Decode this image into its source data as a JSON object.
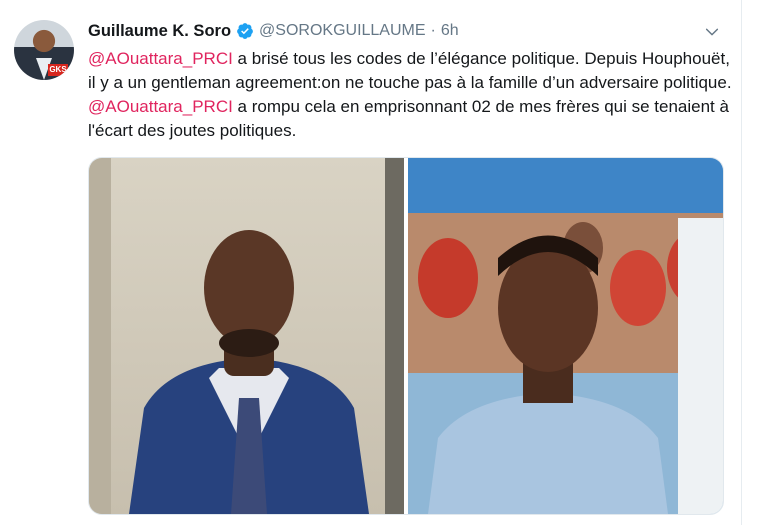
{
  "tweet": {
    "author": {
      "name": "Guillaume K. Soro",
      "verified": true,
      "handle": "@SOROKGUILLAUME",
      "separator": "·",
      "time": "6h",
      "avatar_badge": "GKS"
    },
    "text": {
      "mention1": "@AOuattara_PRCI",
      "part1": " a brisé tous les codes de l’élégance politique. Depuis Houphouët, il y a un gentleman agreement:on ne touche pas à la famille d’un adversaire politique. ",
      "mention2": "@AOuattara_PRCI",
      "part2": " a rompu cela en emprisonnant 02 de mes frères qui se tenaient à l'écart des joutes politiques."
    },
    "media": {
      "photos": [
        {
          "id": "left",
          "subject": "man in blue suit and striped tie in front of a wall"
        },
        {
          "id": "right",
          "subject": "man in light blue shirt with red chairs in background"
        }
      ]
    },
    "icons": {
      "verified": "verified-badge-icon",
      "menu": "chevron-down-icon"
    },
    "colors": {
      "mention": "#e0245e",
      "verified": "#1da1f2",
      "meta": "#657786"
    }
  }
}
